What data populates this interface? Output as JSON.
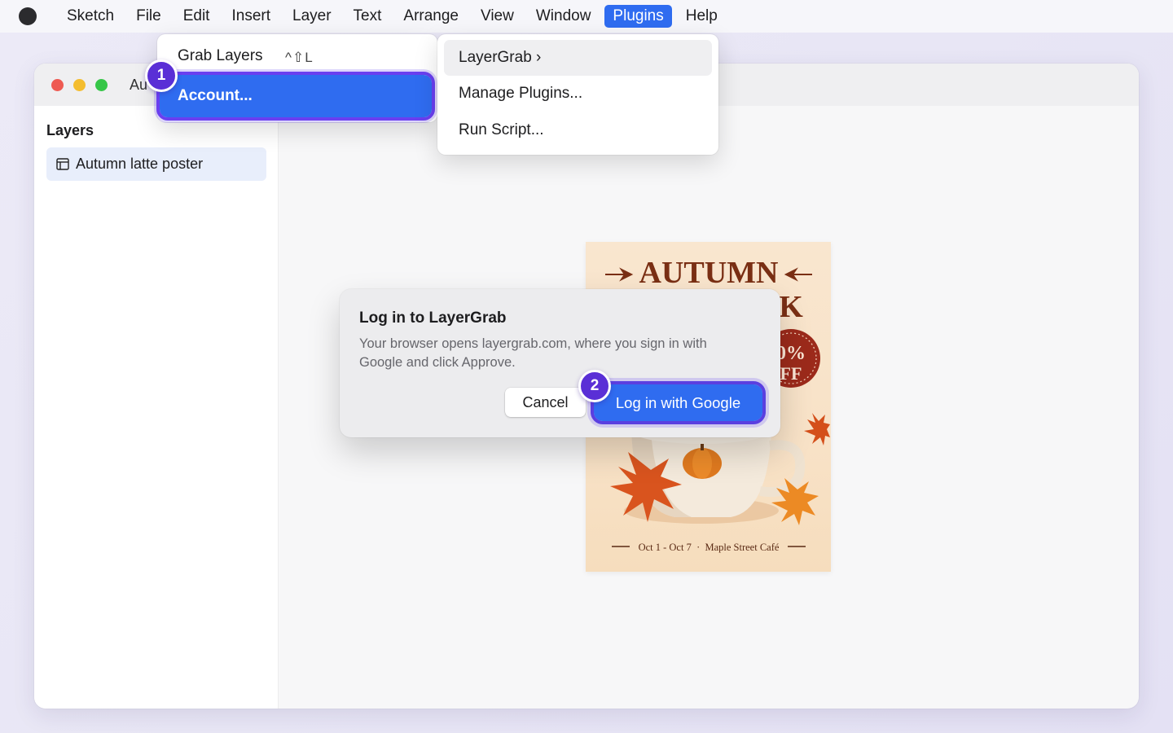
{
  "menubar": {
    "app_icon": "apple-logo-icon",
    "items": [
      "Sketch",
      "File",
      "Edit",
      "Insert",
      "Layer",
      "Text",
      "Arrange",
      "View",
      "Window",
      "Plugins",
      "Help"
    ],
    "active": "Plugins",
    "accent": "#2f6cf0"
  },
  "window": {
    "title": "Au",
    "sidebar": {
      "heading": "Layers",
      "layers": [
        {
          "icon": "frame-icon",
          "label": "Autumn latte poster"
        }
      ]
    }
  },
  "poster": {
    "line1": "AUTUMN",
    "line2": "K",
    "badge_line1": "0%",
    "badge_line2": "FF",
    "footer": "Oct 1 - Oct 7  ·  Maple Street Café"
  },
  "plugins_menu": {
    "items": [
      "LayerGrab ›",
      "Manage Plugins...",
      "Run Script..."
    ],
    "highlighted": "LayerGrab ›"
  },
  "layergrab_submenu": {
    "grab_layers": "Grab Layers",
    "grab_layers_shortcut": "^⇧L",
    "account": "Account..."
  },
  "steps": {
    "one": "1",
    "two": "2",
    "badge_color": "#5a2fd6"
  },
  "dialog": {
    "title": "Log in to LayerGrab",
    "body": "Your browser opens layergrab.com, where you sign in with Google and click Approve.",
    "cancel_label": "Cancel",
    "confirm_label": "Log in with Google"
  }
}
